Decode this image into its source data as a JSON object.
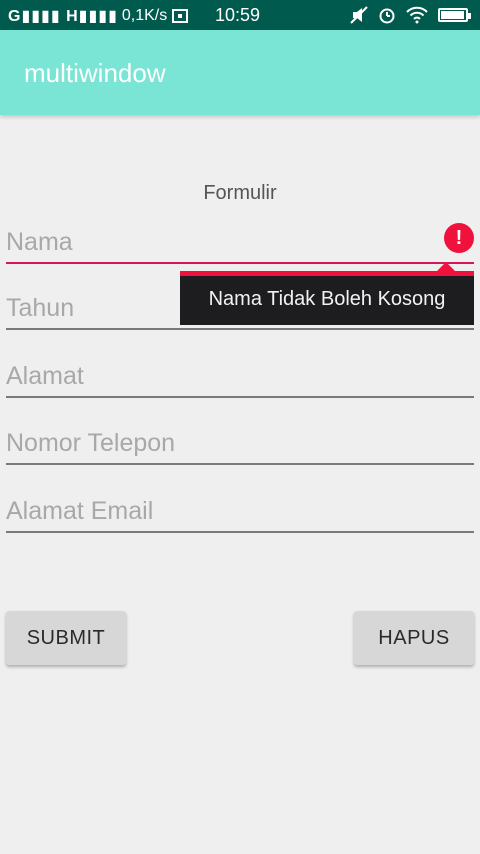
{
  "status_bar": {
    "carrier_text": "G │││ H││││",
    "speed": "0,1K/s",
    "time": "10:59",
    "battery_level": 0.95
  },
  "app_bar": {
    "title": "multiwindow"
  },
  "form": {
    "title": "Formulir",
    "fields": [
      {
        "placeholder": "Nama",
        "value": ""
      },
      {
        "placeholder": "Tahun",
        "value": ""
      },
      {
        "placeholder": "Alamat",
        "value": ""
      },
      {
        "placeholder": "Nomor Telepon",
        "value": ""
      },
      {
        "placeholder": "Alamat Email",
        "value": ""
      }
    ],
    "error": {
      "icon_text": "!",
      "message": "Nama Tidak Boleh Kosong"
    },
    "submit_label": "SUBMIT",
    "reset_label": "HAPUS"
  },
  "colors": {
    "status_bar": "#005b4e",
    "app_bar": "#7ae4d5",
    "error": "#f0123c",
    "error_line": "#d6175a"
  }
}
